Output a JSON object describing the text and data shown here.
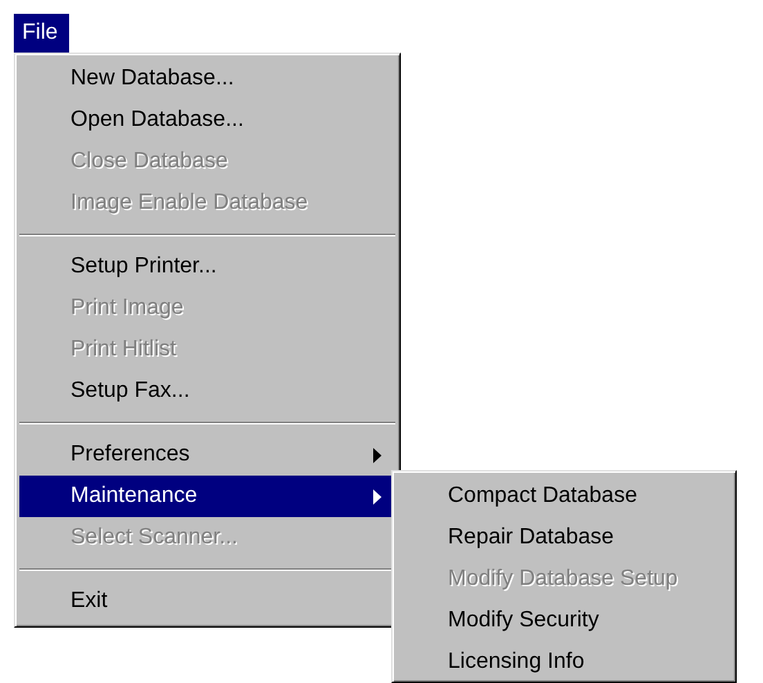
{
  "menubar": [
    {
      "label": "File",
      "selected": true
    }
  ],
  "menu": {
    "items": [
      {
        "kind": "item",
        "label": "New Database...",
        "disabled": false,
        "selected": false,
        "has_submenu": false
      },
      {
        "kind": "item",
        "label": "Open Database...",
        "disabled": false,
        "selected": false,
        "has_submenu": false
      },
      {
        "kind": "item",
        "label": "Close Database",
        "disabled": true,
        "selected": false,
        "has_submenu": false
      },
      {
        "kind": "item",
        "label": "Image Enable Database",
        "disabled": true,
        "selected": false,
        "has_submenu": false
      },
      {
        "kind": "separator"
      },
      {
        "kind": "item",
        "label": "Setup Printer...",
        "disabled": false,
        "selected": false,
        "has_submenu": false
      },
      {
        "kind": "item",
        "label": "Print Image",
        "disabled": true,
        "selected": false,
        "has_submenu": false
      },
      {
        "kind": "item",
        "label": "Print Hitlist",
        "disabled": true,
        "selected": false,
        "has_submenu": false
      },
      {
        "kind": "item",
        "label": "Setup Fax...",
        "disabled": false,
        "selected": false,
        "has_submenu": false
      },
      {
        "kind": "separator"
      },
      {
        "kind": "item",
        "label": "Preferences",
        "disabled": false,
        "selected": false,
        "has_submenu": true
      },
      {
        "kind": "item",
        "label": "Maintenance",
        "disabled": false,
        "selected": true,
        "has_submenu": true
      },
      {
        "kind": "item",
        "label": "Select Scanner...",
        "disabled": true,
        "selected": false,
        "has_submenu": false
      },
      {
        "kind": "separator"
      },
      {
        "kind": "item",
        "label": "Exit",
        "disabled": false,
        "selected": false,
        "has_submenu": false
      }
    ]
  },
  "submenu": {
    "items": [
      {
        "kind": "item",
        "label": "Compact Database",
        "disabled": false,
        "selected": false,
        "has_submenu": false
      },
      {
        "kind": "item",
        "label": "Repair Database",
        "disabled": false,
        "selected": false,
        "has_submenu": false
      },
      {
        "kind": "item",
        "label": "Modify Database Setup",
        "disabled": true,
        "selected": false,
        "has_submenu": false
      },
      {
        "kind": "item",
        "label": "Modify Security",
        "disabled": false,
        "selected": false,
        "has_submenu": false
      },
      {
        "kind": "item",
        "label": "Licensing Info",
        "disabled": false,
        "selected": false,
        "has_submenu": false
      }
    ]
  }
}
